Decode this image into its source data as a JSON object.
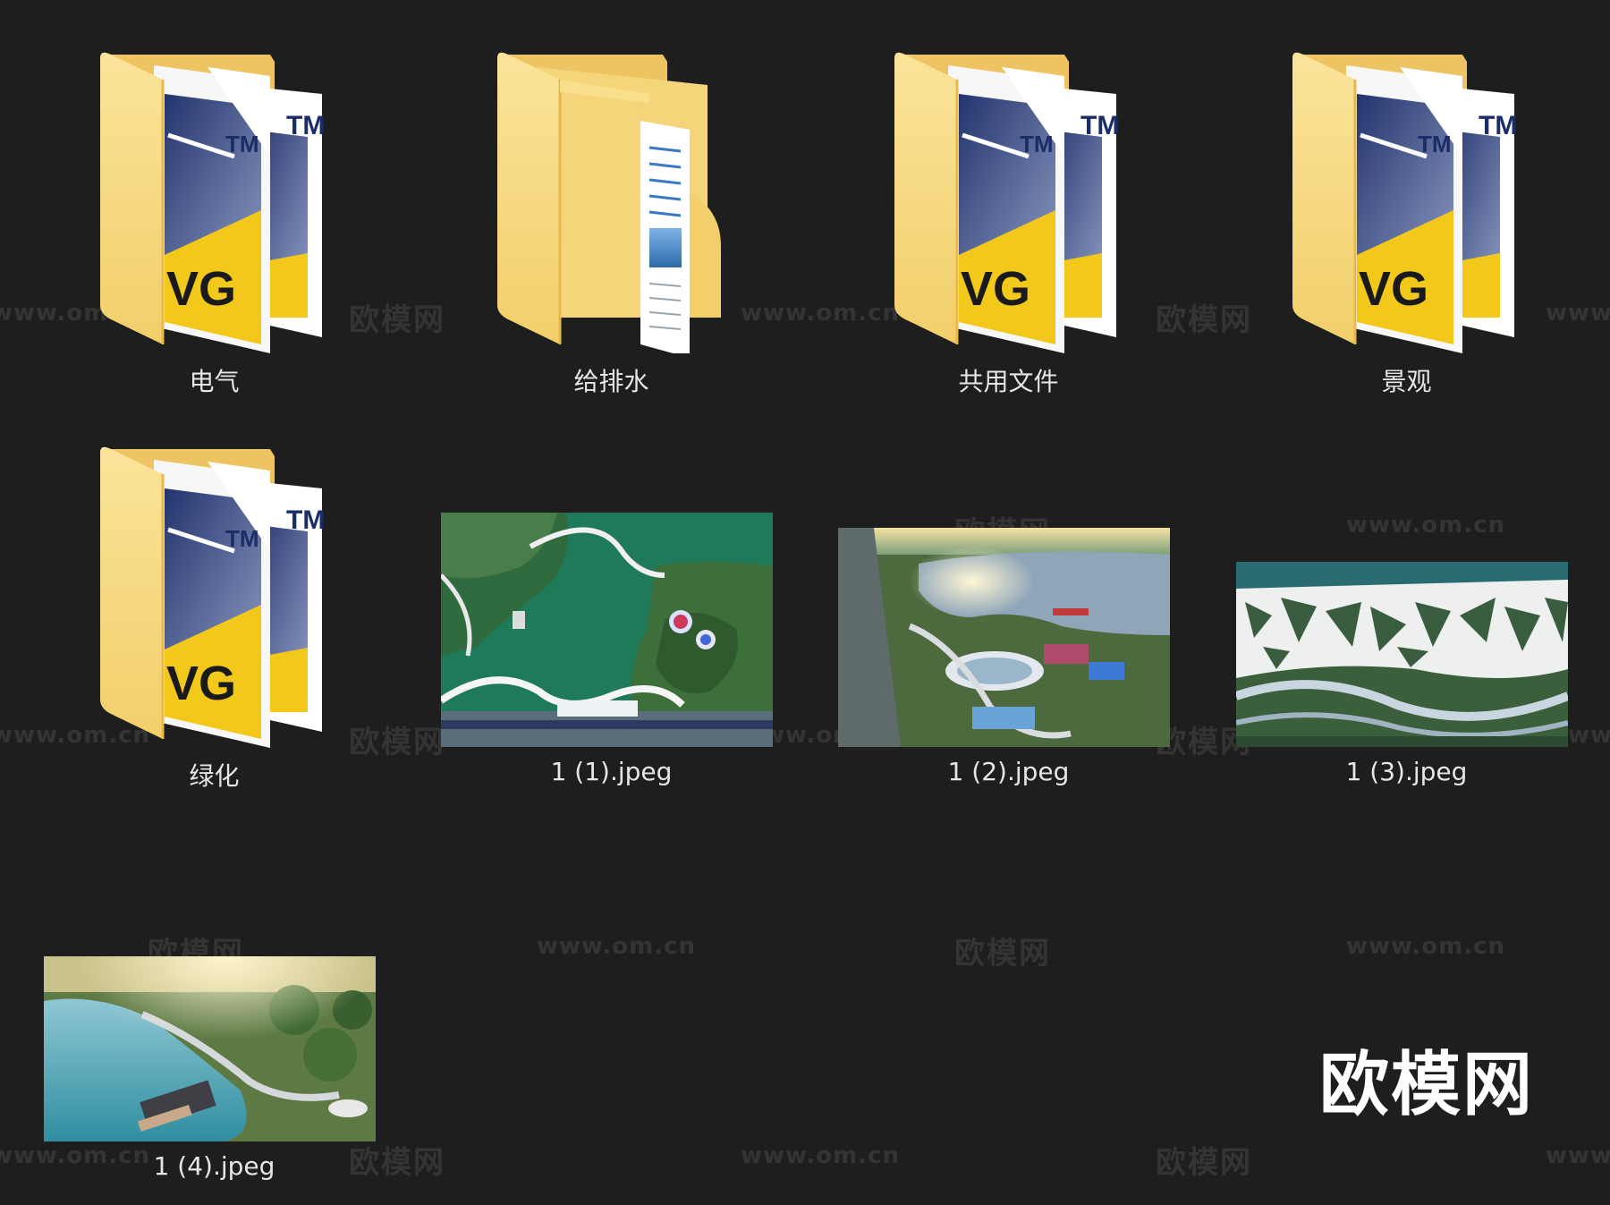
{
  "items": [
    {
      "type": "folder",
      "name": "电气",
      "icon": "folder-vg-icon"
    },
    {
      "type": "folder",
      "name": "给排水",
      "icon": "folder-document-icon"
    },
    {
      "type": "folder",
      "name": "共用文件",
      "icon": "folder-vg-icon"
    },
    {
      "type": "folder",
      "name": "景观",
      "icon": "folder-vg-icon"
    },
    {
      "type": "folder",
      "name": "绿化",
      "icon": "folder-vg-icon"
    },
    {
      "type": "image",
      "name": "1 (1).jpeg",
      "icon": "image-thumbnail"
    },
    {
      "type": "image",
      "name": "1 (2).jpeg",
      "icon": "image-thumbnail"
    },
    {
      "type": "image",
      "name": "1 (3).jpeg",
      "icon": "image-thumbnail"
    },
    {
      "type": "image",
      "name": "1 (4).jpeg",
      "icon": "image-thumbnail"
    }
  ],
  "folder_badge": {
    "tm": "TM",
    "vg": "VG"
  },
  "watermarks": {
    "cn": "欧模网",
    "url": "www.om.cn"
  },
  "brand": "欧模网",
  "colors": {
    "background": "#1e1e1e",
    "folder": "#f7d775",
    "folder_dark": "#e9bf4f",
    "vg_yellow": "#f2c81a",
    "label": "#e6e6e6"
  }
}
